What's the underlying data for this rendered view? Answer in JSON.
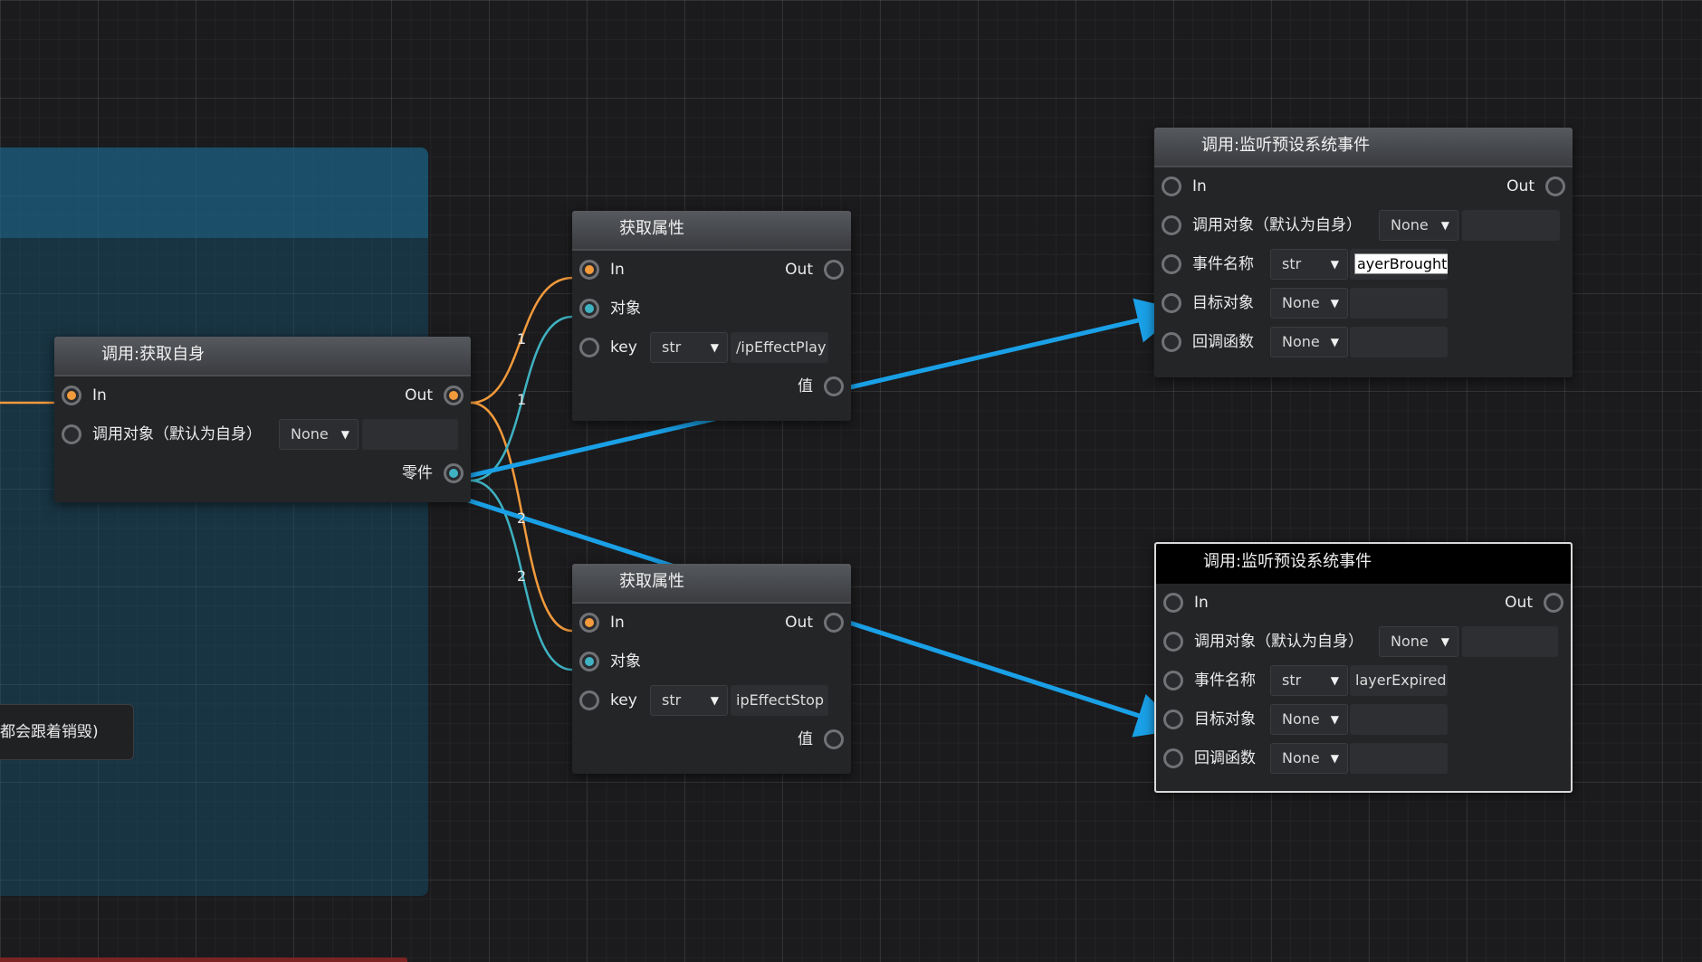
{
  "comment_text": "都会跟着销毁)",
  "node_self": {
    "title": "调用:获取自身",
    "in_label": "In",
    "out_label": "Out",
    "target_label": "调用对象（默认为自身）",
    "target_value": "None",
    "output_label": "零件"
  },
  "node_get1": {
    "title": "获取属性",
    "in_label": "In",
    "out_label": "Out",
    "obj_label": "对象",
    "key_label": "key",
    "key_type": "str",
    "key_value": "ipEffectPlay",
    "key_prefix": "/",
    "value_label": "值"
  },
  "node_get2": {
    "title": "获取属性",
    "in_label": "In",
    "out_label": "Out",
    "obj_label": "对象",
    "key_label": "key",
    "key_type": "str",
    "key_value": "ipEffectStop",
    "value_label": "值"
  },
  "node_listen1": {
    "title": "调用:监听预设系统事件",
    "in_label": "In",
    "out_label": "Out",
    "target_label": "调用对象（默认为自身）",
    "target_value": "None",
    "event_label": "事件名称",
    "event_type": "str",
    "event_value": "ayerBrought",
    "obj_label": "目标对象",
    "obj_value": "None",
    "cb_label": "回调函数",
    "cb_value": "None"
  },
  "node_listen2": {
    "title": "调用:监听预设系统事件",
    "in_label": "In",
    "out_label": "Out",
    "target_label": "调用对象（默认为自身）",
    "target_value": "None",
    "event_label": "事件名称",
    "event_type": "str",
    "event_value": "layerExpired",
    "obj_label": "目标对象",
    "obj_value": "None",
    "cb_label": "回调函数",
    "cb_value": "None"
  },
  "wire_labels": [
    "1",
    "1",
    "2",
    "2"
  ],
  "colors": {
    "exec_wire": "#f39a3c",
    "data_wire": "#3fb2c2",
    "drag_wire": "#1aa0e6"
  }
}
